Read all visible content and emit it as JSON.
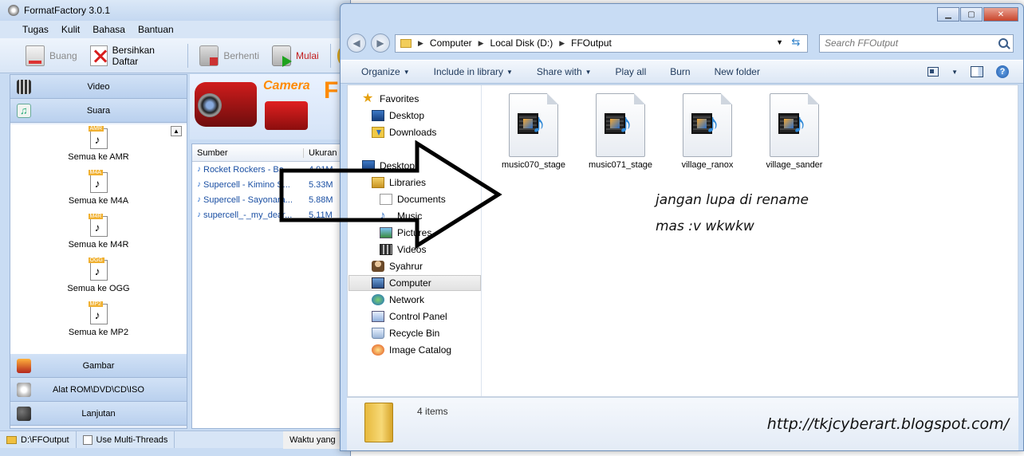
{
  "ff": {
    "title": "FormatFactory 3.0.1",
    "menu": [
      "Tugas",
      "Kulit",
      "Bahasa",
      "Bantuan"
    ],
    "toolbar": {
      "remove": "Buang",
      "clear": "Bersihkan Daftar",
      "stop": "Berhenti",
      "start": "Mulai"
    },
    "categories": {
      "video": "Video",
      "audio": "Suara",
      "image": "Gambar",
      "rom": "Alat ROM\\DVD\\CD\\ISO",
      "advanced": "Lanjutan"
    },
    "audio_items": [
      {
        "tag": "AMR",
        "label": "Semua ke AMR"
      },
      {
        "tag": "M4A",
        "label": "Semua ke M4A"
      },
      {
        "tag": "M4R",
        "label": "Semua ke M4R"
      },
      {
        "tag": "OGG",
        "label": "Semua ke OGG"
      },
      {
        "tag": "MP2",
        "label": "Semua ke MP2"
      }
    ],
    "banner_text": "Camera",
    "banner_letter": "F",
    "file_list": {
      "col_source": "Sumber",
      "col_size": "Ukuran",
      "rows": [
        {
          "name": "Rocket Rockers - Ba...",
          "size": "4.91M"
        },
        {
          "name": "Supercell - Kimino S...",
          "size": "5.33M"
        },
        {
          "name": "Supercell - Sayonara...",
          "size": "5.88M"
        },
        {
          "name": "supercell_-_my_dear...",
          "size": "5.11M"
        }
      ]
    },
    "status": {
      "output_folder": "D:\\FFOutput",
      "multithread": "Use Multi-Threads",
      "elapsed": "Waktu yang"
    }
  },
  "explorer": {
    "address": {
      "parts": [
        "Computer",
        "Local Disk (D:)",
        "FFOutput"
      ]
    },
    "search_placeholder": "Search FFOutput",
    "commands": {
      "organize": "Organize",
      "include": "Include in library",
      "share": "Share with",
      "play": "Play all",
      "burn": "Burn",
      "newfolder": "New folder"
    },
    "nav": {
      "favorites": "Favorites",
      "desktop": "Desktop",
      "downloads": "Downloads",
      "desktop2": "Desktop",
      "libraries": "Libraries",
      "documents": "Documents",
      "music": "Music",
      "pictures": "Pictures",
      "videos": "Videos",
      "user": "Syahrur",
      "computer": "Computer",
      "network": "Network",
      "control_panel": "Control Panel",
      "recycle_bin": "Recycle Bin",
      "image_catalog": "Image Catalog"
    },
    "files": [
      "music070_stage",
      "music071_stage",
      "village_ranox",
      "village_sander"
    ],
    "details_count": "4 items"
  },
  "annotation": {
    "line1": "jangan lupa di rename",
    "line2": "mas :v wkwkw",
    "url": "http://tkjcyberart.blogspot.com/"
  }
}
